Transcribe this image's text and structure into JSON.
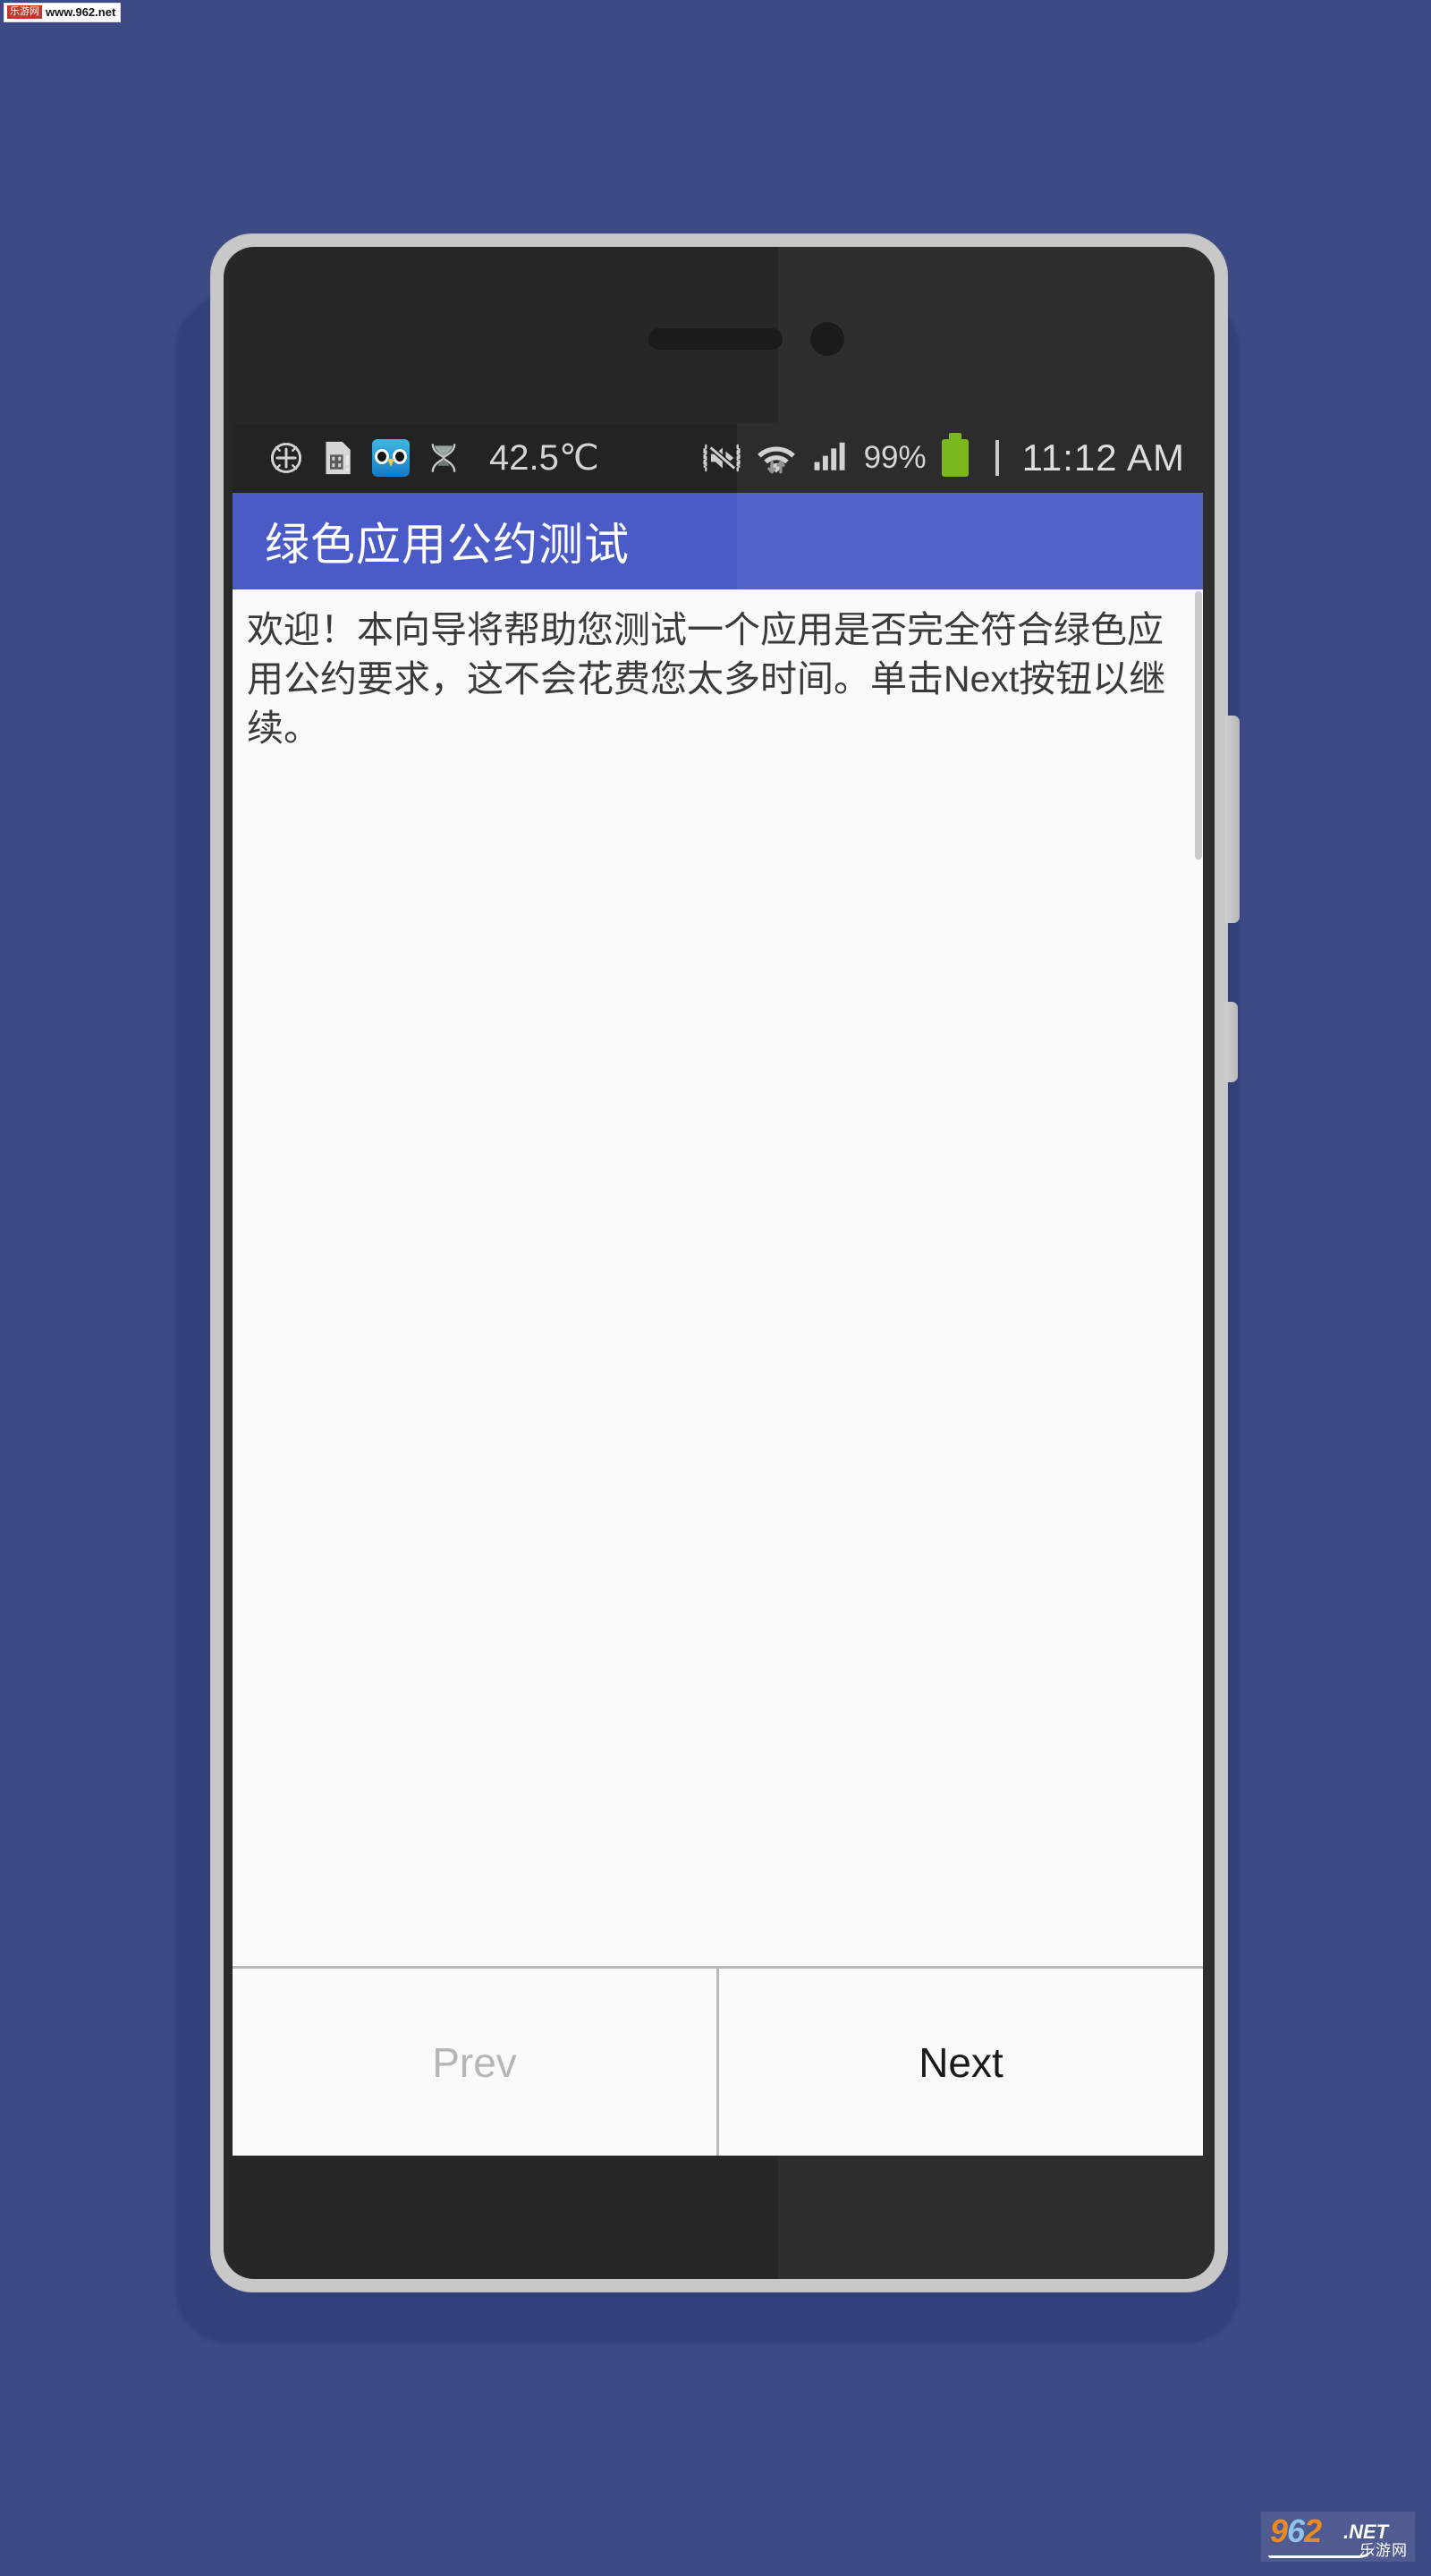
{
  "page": {
    "background_color": "#3d4a85",
    "device": "android-phone-mockup"
  },
  "watermark_top_left": {
    "tag": "乐游网",
    "url": "www.962.net"
  },
  "watermark_bottom_right": {
    "digit1": "9",
    "digit2": "6",
    "digit3": "2",
    "suffix": ".NET",
    "chinese": "乐游网"
  },
  "status_bar": {
    "background_color": "#232323",
    "left_icons": [
      {
        "name": "gps-crosshair-icon",
        "label": "GPS"
      },
      {
        "name": "sim-card-alert-icon",
        "label": "SIM"
      },
      {
        "name": "owl-app-icon",
        "label": "Owl"
      },
      {
        "name": "hourglass-icon",
        "label": "Hourglass"
      }
    ],
    "temperature": "42.5℃",
    "right_icons": [
      {
        "name": "mute-vibrate-icon",
        "label": "Silent"
      },
      {
        "name": "wifi-icon",
        "label": "Wi-Fi"
      },
      {
        "name": "cellular-signal-icon",
        "label": "Signal"
      }
    ],
    "battery_percent": "99%",
    "battery_color": "#7ab81e",
    "clock": "11:12 AM"
  },
  "app_bar": {
    "title": "绿色应用公约测试",
    "background_color": "#4a5bc8",
    "text_color": "#ffffff"
  },
  "content": {
    "wizard_text": "欢迎！本向导将帮助您测试一个应用是否完全符合绿色应用公约要求，这不会花费您太多时间。单击Next按钮以继续。",
    "background_color": "#fafafa"
  },
  "buttons": {
    "prev_label": "Prev",
    "prev_enabled": false,
    "prev_color": "#b6b6b6",
    "next_label": "Next",
    "next_enabled": true,
    "next_color": "#1a1a1a"
  },
  "hardware": {
    "volume_rocker": "volume-rocker",
    "power_button": "power-button",
    "earpiece": "earpiece-speaker",
    "front_camera": "front-camera"
  }
}
